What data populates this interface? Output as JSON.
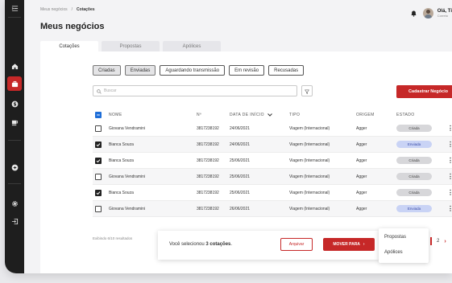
{
  "sidebar": {
    "icons": [
      "menu-expand-icon",
      "home-icon",
      "briefcase-icon",
      "dollar-icon",
      "coffee-icon",
      "plus-icon",
      "gear-icon",
      "logout-icon"
    ],
    "active": "briefcase-icon"
  },
  "breadcrumb": {
    "root": "Meus negócios",
    "separator": "/",
    "current": "Cotações"
  },
  "header": {
    "title": "Meus negócios",
    "greeting": "Olá, Ti",
    "role": "Correto"
  },
  "tabs": [
    {
      "label": "Cotações",
      "active": true
    },
    {
      "label": "Propostas",
      "active": false
    },
    {
      "label": "Apólices",
      "active": false
    }
  ],
  "filters": [
    {
      "label": "Criadas",
      "selected": true
    },
    {
      "label": "Enviadas",
      "selected": true
    },
    {
      "label": "Aguardando transmissão",
      "selected": false
    },
    {
      "label": "Em revisão",
      "selected": false
    },
    {
      "label": "Recusadas",
      "selected": false
    }
  ],
  "search": {
    "placeholder": "Buscar",
    "value": ""
  },
  "actions": {
    "new_label": "Cadastrar Negócio"
  },
  "table": {
    "columns": {
      "nome": "NOME",
      "num": "Nº",
      "data": "DATA DE INÍCIO",
      "tipo": "TIPO",
      "origem": "ORIGEM",
      "estado": "ESTADO"
    },
    "rows": [
      {
        "checked": false,
        "nome": "Giovana Vendramini",
        "num": "3817238192",
        "data": "24/06/2021",
        "tipo": "Viagem (Internacional)",
        "origem": "Agger",
        "estado": "Criada"
      },
      {
        "checked": true,
        "nome": "Bianca Souza",
        "num": "3817238192",
        "data": "24/06/2021",
        "tipo": "Viagem (Internacional)",
        "origem": "Agger",
        "estado": "Enviada"
      },
      {
        "checked": true,
        "nome": "Bianca Souza",
        "num": "3817238192",
        "data": "25/06/2021",
        "tipo": "Viagem (Internacional)",
        "origem": "Agger",
        "estado": "Criada"
      },
      {
        "checked": false,
        "nome": "Giovana Vendramini",
        "num": "3817238192",
        "data": "25/06/2021",
        "tipo": "Viagem (Internacional)",
        "origem": "Agger",
        "estado": "Criada"
      },
      {
        "checked": true,
        "nome": "Bianca Souza",
        "num": "3817238192",
        "data": "25/06/2021",
        "tipo": "Viagem (Internacional)",
        "origem": "Agger",
        "estado": "Criada"
      },
      {
        "checked": false,
        "nome": "Giovana Vendramini",
        "num": "3817238192",
        "data": "26/06/2021",
        "tipo": "Viagem (Internacional)",
        "origem": "Agger",
        "estado": "Enviada"
      }
    ]
  },
  "footer": {
    "results": "Exibindo 6/10 resultados",
    "selected_prefix": "Você selecionou ",
    "selected_count": "3 cotações",
    "selected_suffix": ".",
    "archive_label": "Arquivar",
    "move_label": "MOVER PARA",
    "move_arrow": "›",
    "dropdown": [
      "Propostas",
      "Apólices"
    ],
    "pagination": {
      "page": "2",
      "next": "›"
    }
  }
}
